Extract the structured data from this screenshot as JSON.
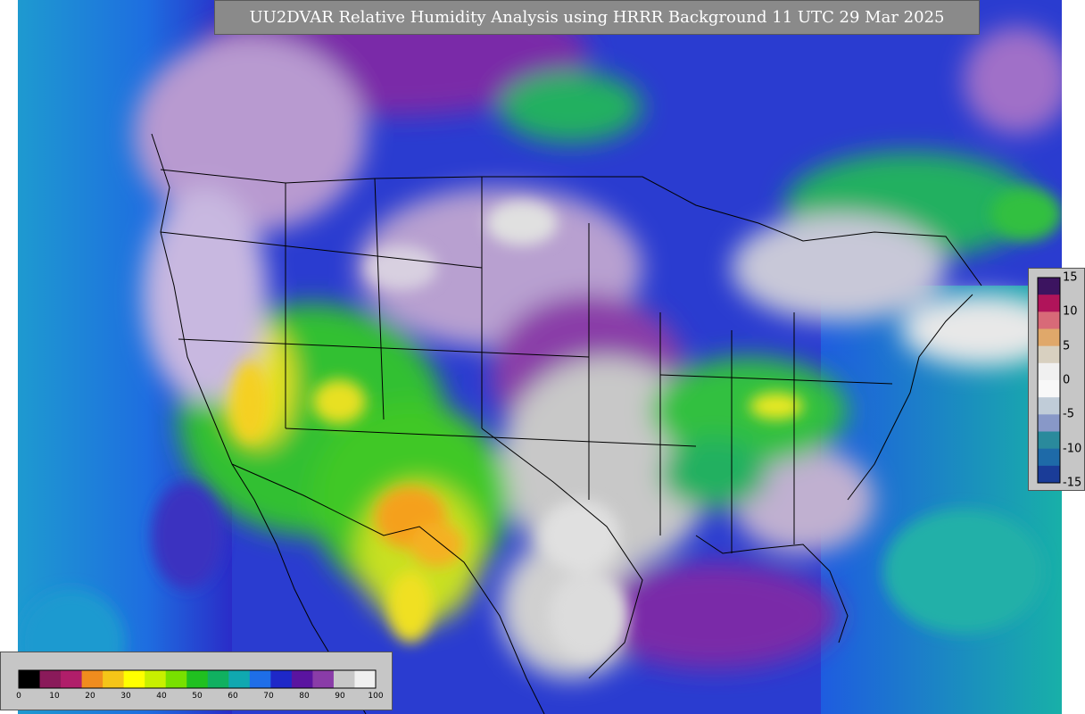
{
  "title": "UU2DVAR Relative Humidity Analysis using HRRR Background 11 UTC 29 Mar 2025",
  "rh_colorbar": {
    "ticks": [
      "0",
      "10",
      "20",
      "30",
      "40",
      "50",
      "60",
      "70",
      "80",
      "90",
      "100"
    ],
    "colors": [
      "#000000",
      "#8a1a5a",
      "#b01e6a",
      "#f08c1e",
      "#f5c518",
      "#ffff00",
      "#c8f000",
      "#78e000",
      "#20c020",
      "#10b060",
      "#10a8b0",
      "#1e6ee8",
      "#1e28c8",
      "#5a14a0",
      "#8a3ca8",
      "#c8c8c8",
      "#f0f0f0"
    ]
  },
  "increment_colorbar": {
    "ticks": [
      "15",
      "10",
      "5",
      "0",
      "-5",
      "-10",
      "-15"
    ],
    "colors": [
      "#3c1460",
      "#b0145a",
      "#d86a78",
      "#e0a86a",
      "#d8d0c0",
      "#f0f0f0",
      "#f8f8f8",
      "#c0ccd8",
      "#8898c8",
      "#2a8a9c",
      "#1e6aa8",
      "#1a3c98"
    ]
  }
}
